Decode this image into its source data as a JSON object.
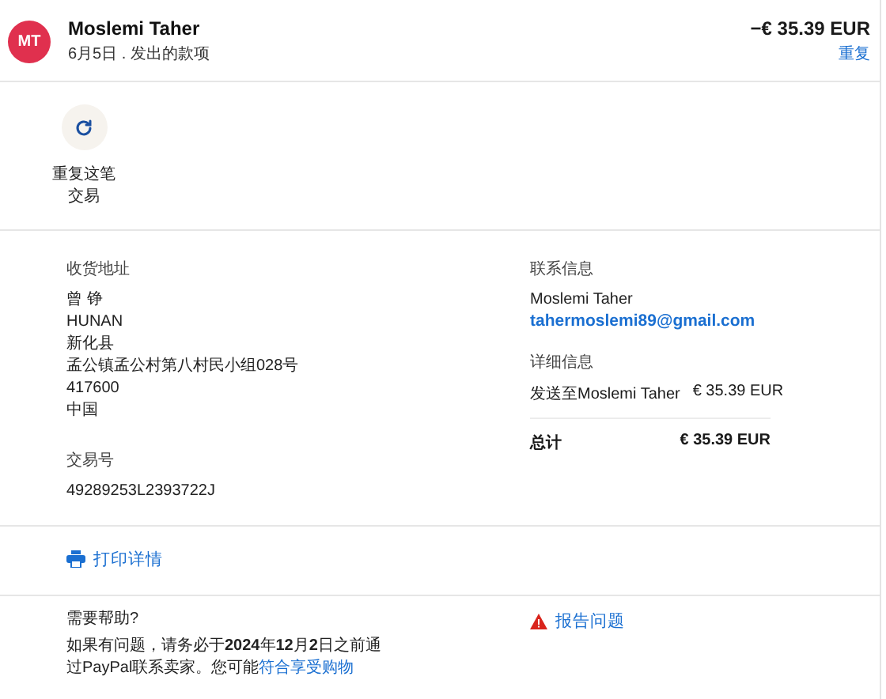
{
  "header": {
    "avatar": "MT",
    "name": "Moslemi Taher",
    "subtitle": "6月5日 . 发出的款项",
    "amount": "−€ 35.39 EUR",
    "repeat_link": "重复"
  },
  "actions": [
    {
      "label": "重复这笔交易"
    }
  ],
  "shipping": {
    "title": "收货地址",
    "lines": [
      "曾 铮",
      "HUNAN",
      "新化县",
      "孟公镇孟公村第八村民小组028号",
      "417600",
      "中国"
    ]
  },
  "transaction": {
    "title": "交易号",
    "value": "49289253L2393722J"
  },
  "contact": {
    "title": "联系信息",
    "name": "Moslemi Taher",
    "email": "tahermoslemi89@gmail.com"
  },
  "details": {
    "title": "详细信息",
    "rows": [
      {
        "label": "发送至Moslemi Taher",
        "value": "€ 35.39 EUR",
        "kind": "item"
      },
      {
        "label": "总计",
        "value": "€ 35.39 EUR",
        "kind": "total"
      }
    ]
  },
  "print_link": "打印详情",
  "help": {
    "title": "需要帮助?",
    "text": "如果有问题，请务必于**2024**年**12**月**2**日之前通过PayPal联系卖家。您可能",
    "link": "符合享受购物",
    "report_link": "报告问题"
  }
}
